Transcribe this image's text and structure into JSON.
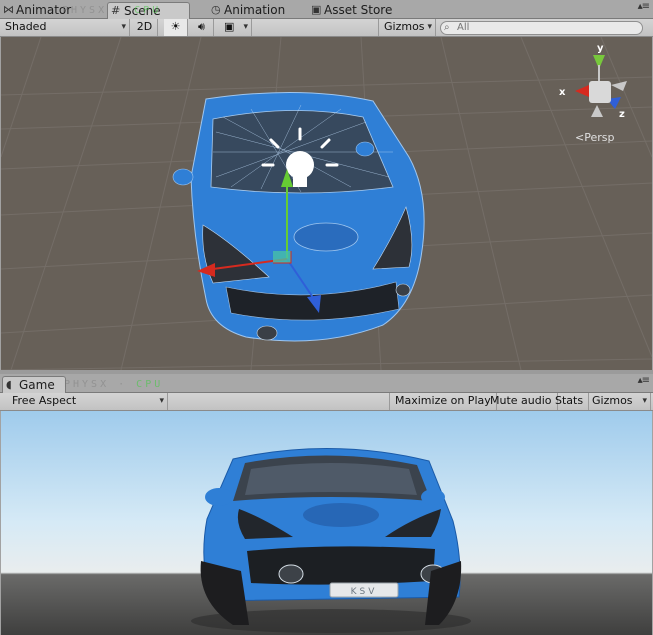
{
  "scene_tabs": [
    {
      "label": "Animator",
      "icon": "animator-icon"
    },
    {
      "label": "Scene",
      "icon": "scene-icon"
    },
    {
      "label": "Animation",
      "icon": "animation-clock-icon"
    },
    {
      "label": "Asset Store",
      "icon": "asset-store-icon"
    }
  ],
  "watermark": {
    "prefix": "PHYSX",
    "suffix": "CPU"
  },
  "scene_toolbar": {
    "draw_mode": "Shaded",
    "mode_2d": "2D",
    "lighting_icon": "sun-icon",
    "audio_icon": "speaker-icon",
    "effects_icon": "image-icon",
    "gizmos": "Gizmos",
    "search_placeholder": "All"
  },
  "scene_view": {
    "persp_label": "Persp",
    "axis_labels": {
      "x": "x",
      "y": "y",
      "z": "z"
    },
    "background": "#676058",
    "car_color": "#2f7fd6"
  },
  "game_tab": {
    "label": "Game",
    "icon": "game-pacman-icon"
  },
  "game_toolbar": {
    "aspect": "Free Aspect",
    "maximize": "Maximize on Play",
    "mute": "Mute audio",
    "stats": "Stats",
    "gizmos": "Gizmos"
  },
  "game_view": {
    "license_plate": "KSV",
    "sky_color": "#c6e2f4",
    "ground_color": "#474746"
  }
}
